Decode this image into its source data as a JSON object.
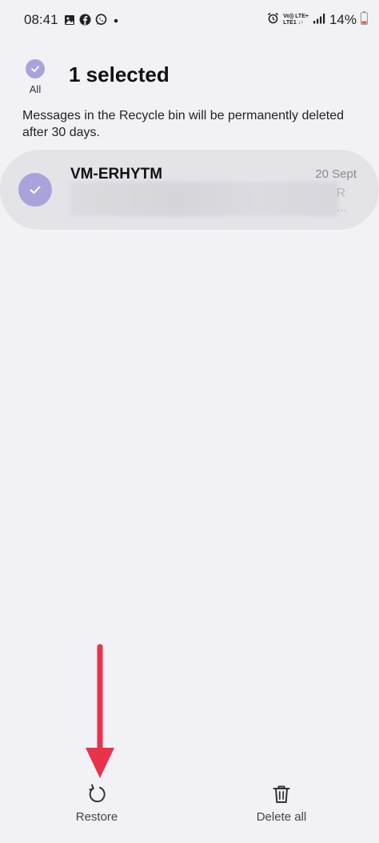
{
  "status_bar": {
    "time": "08:41",
    "network_line1": "Vo)) LTE+",
    "network_line2": "LTE1 ↓↑",
    "battery_percent": "14%",
    "battery_color": "#e0603a",
    "icons": [
      "gallery-icon",
      "facebook-icon",
      "whatsapp-icon",
      "dot-icon",
      "alarm-icon",
      "signal-icon",
      "battery-icon"
    ]
  },
  "header": {
    "select_all_label": "All",
    "title": "1 selected"
  },
  "info": {
    "text": "Messages in the Recycle bin will be permanently deleted after 30 days."
  },
  "messages": [
    {
      "sender": "VM-ERHYTM",
      "date": "20 Sept",
      "preview_tail_1": "R",
      "preview_tail_2": "...",
      "selected": true
    }
  ],
  "bottom_bar": {
    "restore_label": "Restore",
    "delete_all_label": "Delete all"
  },
  "colors": {
    "accent": "#a9a3dc",
    "background": "#f2f1f6",
    "card": "#e4e3e8",
    "annotation_arrow": "#e8334a"
  }
}
